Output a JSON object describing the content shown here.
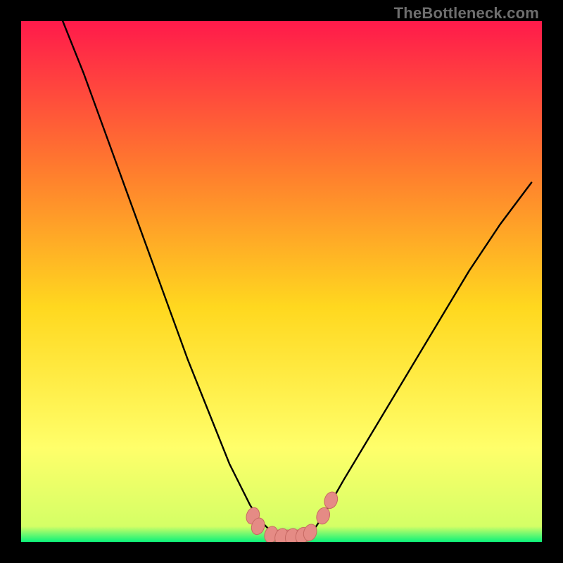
{
  "watermark": "TheBottleneck.com",
  "colors": {
    "frame": "#000000",
    "gradient_top": "#ff1a4b",
    "gradient_mid_top": "#ff7a2e",
    "gradient_mid": "#ffd81f",
    "gradient_mid_bottom": "#ffff6a",
    "gradient_bottom": "#0cf27a",
    "curve": "#000000",
    "marker_fill": "#e58b85",
    "marker_stroke": "#c76a63"
  },
  "chart_data": {
    "type": "line",
    "title": "",
    "xlabel": "",
    "ylabel": "",
    "xlim": [
      0,
      100
    ],
    "ylim": [
      0,
      100
    ],
    "series": [
      {
        "name": "bottleneck-curve",
        "x": [
          8,
          12,
          16,
          20,
          24,
          28,
          32,
          36,
          40,
          42,
          44,
          46,
          48,
          50,
          52,
          54,
          56,
          58,
          62,
          68,
          74,
          80,
          86,
          92,
          98
        ],
        "y": [
          100,
          90,
          79,
          68,
          57,
          46,
          35,
          25,
          15,
          11,
          7,
          4,
          2,
          1,
          1,
          1,
          2,
          5,
          12,
          22,
          32,
          42,
          52,
          61,
          69
        ]
      }
    ],
    "markers": [
      {
        "name": "left-cluster-point-a",
        "x": 44.5,
        "y": 5
      },
      {
        "name": "left-cluster-point-b",
        "x": 45.5,
        "y": 3
      },
      {
        "name": "bottom-cluster-a",
        "x": 48,
        "y": 1.4
      },
      {
        "name": "bottom-cluster-b",
        "x": 50,
        "y": 1.0
      },
      {
        "name": "bottom-cluster-c",
        "x": 52,
        "y": 1.0
      },
      {
        "name": "bottom-cluster-d",
        "x": 54,
        "y": 1.2
      },
      {
        "name": "bottom-cluster-e",
        "x": 55.5,
        "y": 1.8
      },
      {
        "name": "right-cluster-point-a",
        "x": 58,
        "y": 5
      },
      {
        "name": "right-cluster-point-b",
        "x": 59.5,
        "y": 8
      }
    ]
  }
}
